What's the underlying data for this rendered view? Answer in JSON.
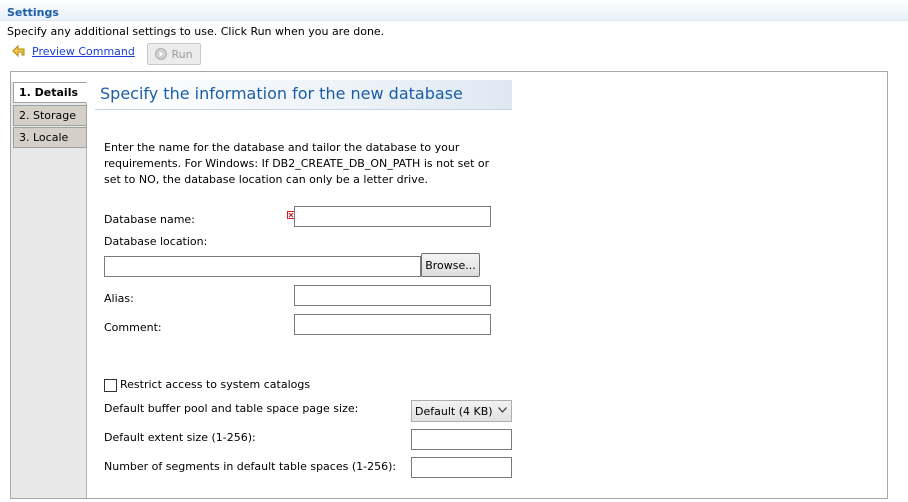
{
  "header": {
    "title": "Settings",
    "instructions": "Specify any additional settings to use. Click Run when you are done."
  },
  "toolbar": {
    "preview_label": "Preview Command",
    "run_label": "Run"
  },
  "tabs": [
    {
      "label": "1. Details",
      "active": true
    },
    {
      "label": "2. Storage",
      "active": false
    },
    {
      "label": "3. Locale",
      "active": false
    }
  ],
  "section": {
    "title": "Specify the information for the new database",
    "description": "Enter the name for the database and tailor the database to your requirements. For Windows: If DB2_CREATE_DB_ON_PATH is not set or set to NO, the database location can only be a letter drive."
  },
  "form": {
    "database_name": {
      "label": "Database name:",
      "value": ""
    },
    "database_location": {
      "label": "Database location:",
      "value": ""
    },
    "browse_label": "Browse...",
    "alias": {
      "label": "Alias:",
      "value": ""
    },
    "comment": {
      "label": "Comment:",
      "value": ""
    },
    "restrict_access": {
      "label": "Restrict access to system catalogs",
      "checked": false
    },
    "buffer_pool": {
      "label": "Default buffer pool and table space page size:",
      "selected": "Default (4 KB)"
    },
    "extent_size": {
      "label": "Default extent size (1-256):",
      "value": ""
    },
    "segments": {
      "label": "Number of segments in default table spaces (1-256):",
      "value": ""
    }
  },
  "colors": {
    "accent": "#1a5ea8",
    "link": "#1a3fd6",
    "error": "#cc2222"
  },
  "icons": {
    "preview": "preview-command-icon",
    "run": "run-play-icon",
    "error": "error-x-icon",
    "dropdown": "chevron-down-icon"
  }
}
